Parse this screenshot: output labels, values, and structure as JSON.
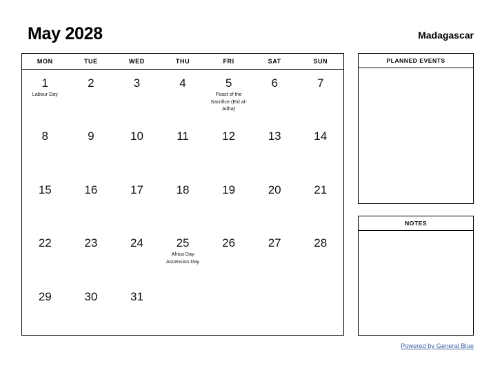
{
  "header": {
    "title": "May 2028",
    "country": "Madagascar"
  },
  "calendar": {
    "weekdays": [
      "MON",
      "TUE",
      "WED",
      "THU",
      "FRI",
      "SAT",
      "SUN"
    ],
    "weeks": [
      [
        {
          "day": "1",
          "events": [
            "Labour Day"
          ]
        },
        {
          "day": "2",
          "events": []
        },
        {
          "day": "3",
          "events": []
        },
        {
          "day": "4",
          "events": []
        },
        {
          "day": "5",
          "events": [
            "Feast of the Sacrifice (Eid al-Adha)"
          ]
        },
        {
          "day": "6",
          "events": []
        },
        {
          "day": "7",
          "events": []
        }
      ],
      [
        {
          "day": "8",
          "events": []
        },
        {
          "day": "9",
          "events": []
        },
        {
          "day": "10",
          "events": []
        },
        {
          "day": "11",
          "events": []
        },
        {
          "day": "12",
          "events": []
        },
        {
          "day": "13",
          "events": []
        },
        {
          "day": "14",
          "events": []
        }
      ],
      [
        {
          "day": "15",
          "events": []
        },
        {
          "day": "16",
          "events": []
        },
        {
          "day": "17",
          "events": []
        },
        {
          "day": "18",
          "events": []
        },
        {
          "day": "19",
          "events": []
        },
        {
          "day": "20",
          "events": []
        },
        {
          "day": "21",
          "events": []
        }
      ],
      [
        {
          "day": "22",
          "events": []
        },
        {
          "day": "23",
          "events": []
        },
        {
          "day": "24",
          "events": []
        },
        {
          "day": "25",
          "events": [
            "Africa Day",
            "Ascension Day"
          ]
        },
        {
          "day": "26",
          "events": []
        },
        {
          "day": "27",
          "events": []
        },
        {
          "day": "28",
          "events": []
        }
      ],
      [
        {
          "day": "29",
          "events": []
        },
        {
          "day": "30",
          "events": []
        },
        {
          "day": "31",
          "events": []
        },
        {
          "day": "",
          "events": []
        },
        {
          "day": "",
          "events": []
        },
        {
          "day": "",
          "events": []
        },
        {
          "day": "",
          "events": []
        }
      ]
    ]
  },
  "panels": {
    "planned_events": {
      "title": "PLANNED EVENTS"
    },
    "notes": {
      "title": "NOTES"
    }
  },
  "footer": {
    "link_label": "Powered by General Blue",
    "link_color": "#3c5fa6"
  }
}
